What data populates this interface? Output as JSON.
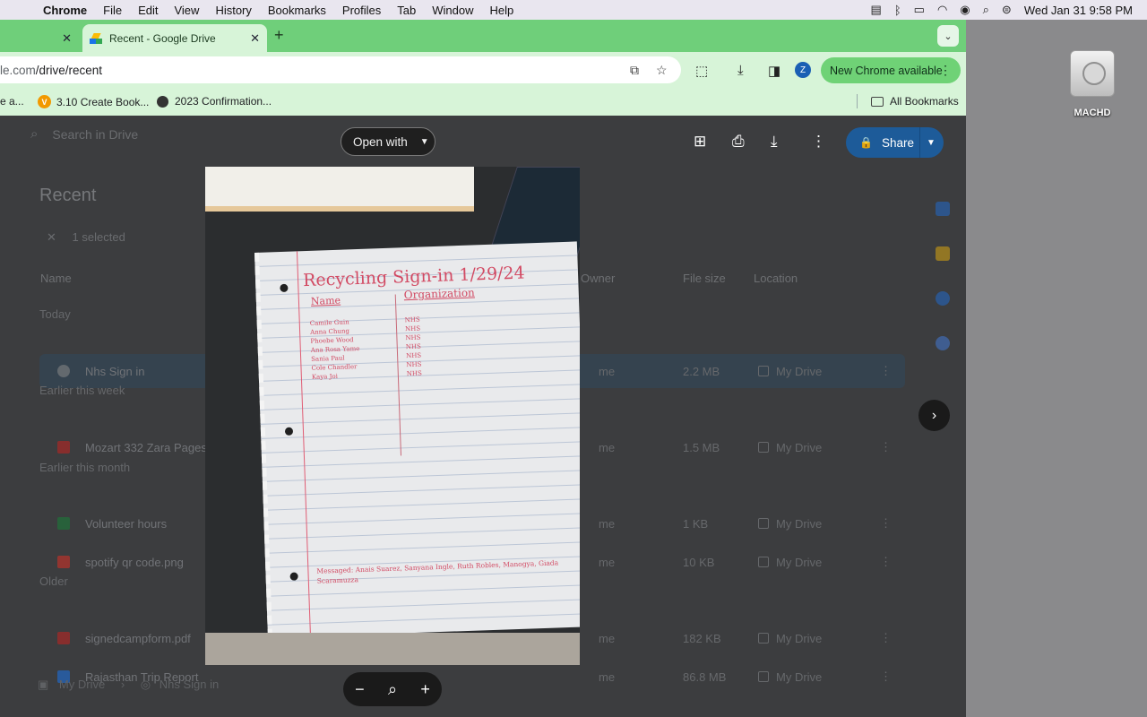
{
  "menubar": {
    "app": "Chrome",
    "items": [
      "File",
      "Edit",
      "View",
      "History",
      "Bookmarks",
      "Profiles",
      "Tab",
      "Window",
      "Help"
    ],
    "clock": "Wed Jan 31  9:58 PM"
  },
  "desktop": {
    "disk_label": "MACHD"
  },
  "browser": {
    "tab_active_title": "Recent - Google Drive",
    "url_dim": "le.com",
    "url_path": "/drive/recent",
    "update_label": "New Chrome available",
    "avatar_letter": "Z",
    "bookmarks": [
      "e a...",
      "3.10 Create Book...",
      "2023 Confirmation...",
      "All Bookmarks"
    ]
  },
  "drive": {
    "search_placeholder": "Search in Drive",
    "title": "Recent",
    "selected_text": "1 selected",
    "columns": {
      "name": "Name",
      "owner": "Owner",
      "size": "File size",
      "location": "Location"
    },
    "groups": [
      "Today",
      "Earlier this week",
      "Earlier this month",
      "Older"
    ],
    "rows": [
      {
        "name": "Nhs Sign in",
        "owner": "me",
        "size": "2.2 MB",
        "location": "My Drive"
      },
      {
        "name": "Mozart 332 Zara Pages",
        "owner": "me",
        "size": "1.5 MB",
        "location": "My Drive"
      },
      {
        "name": "Volunteer hours",
        "owner": "me",
        "size": "1 KB",
        "location": "My Drive"
      },
      {
        "name": "spotify qr code.png",
        "owner": "me",
        "size": "10 KB",
        "location": "My Drive"
      },
      {
        "name": "signedcampform.pdf",
        "owner": "me",
        "size": "182 KB",
        "location": "My Drive"
      },
      {
        "name": "Rajasthan Trip Report",
        "owner": "me",
        "size": "86.8 MB",
        "location": "My Drive"
      }
    ],
    "breadcrumb": [
      "My Drive",
      "Nhs Sign in"
    ]
  },
  "preview": {
    "open_with": "Open with",
    "share": "Share",
    "note_title": "Recycling Sign-in 1/29/24",
    "note_col1": "Name",
    "note_col2": "Organization",
    "note_names": [
      "Camile Guin",
      "Anna Chung",
      "Phoebe Wood",
      "Ana Rosa Yame",
      "Sania Paul",
      "Cole Chandler",
      "Kaya Joi"
    ],
    "note_orgs": [
      "NHS",
      "NHS",
      "NHS",
      "NHS",
      "NHS",
      "NHS",
      "NHS"
    ],
    "note_footer": "Messaged: Anais Suarez, Sanyana Ingle, Ruth Robles, Manogya, Giada Scaramuzza"
  },
  "colors": {
    "accent_green": "#6fcf7a",
    "share_blue": "#1d5b99"
  }
}
